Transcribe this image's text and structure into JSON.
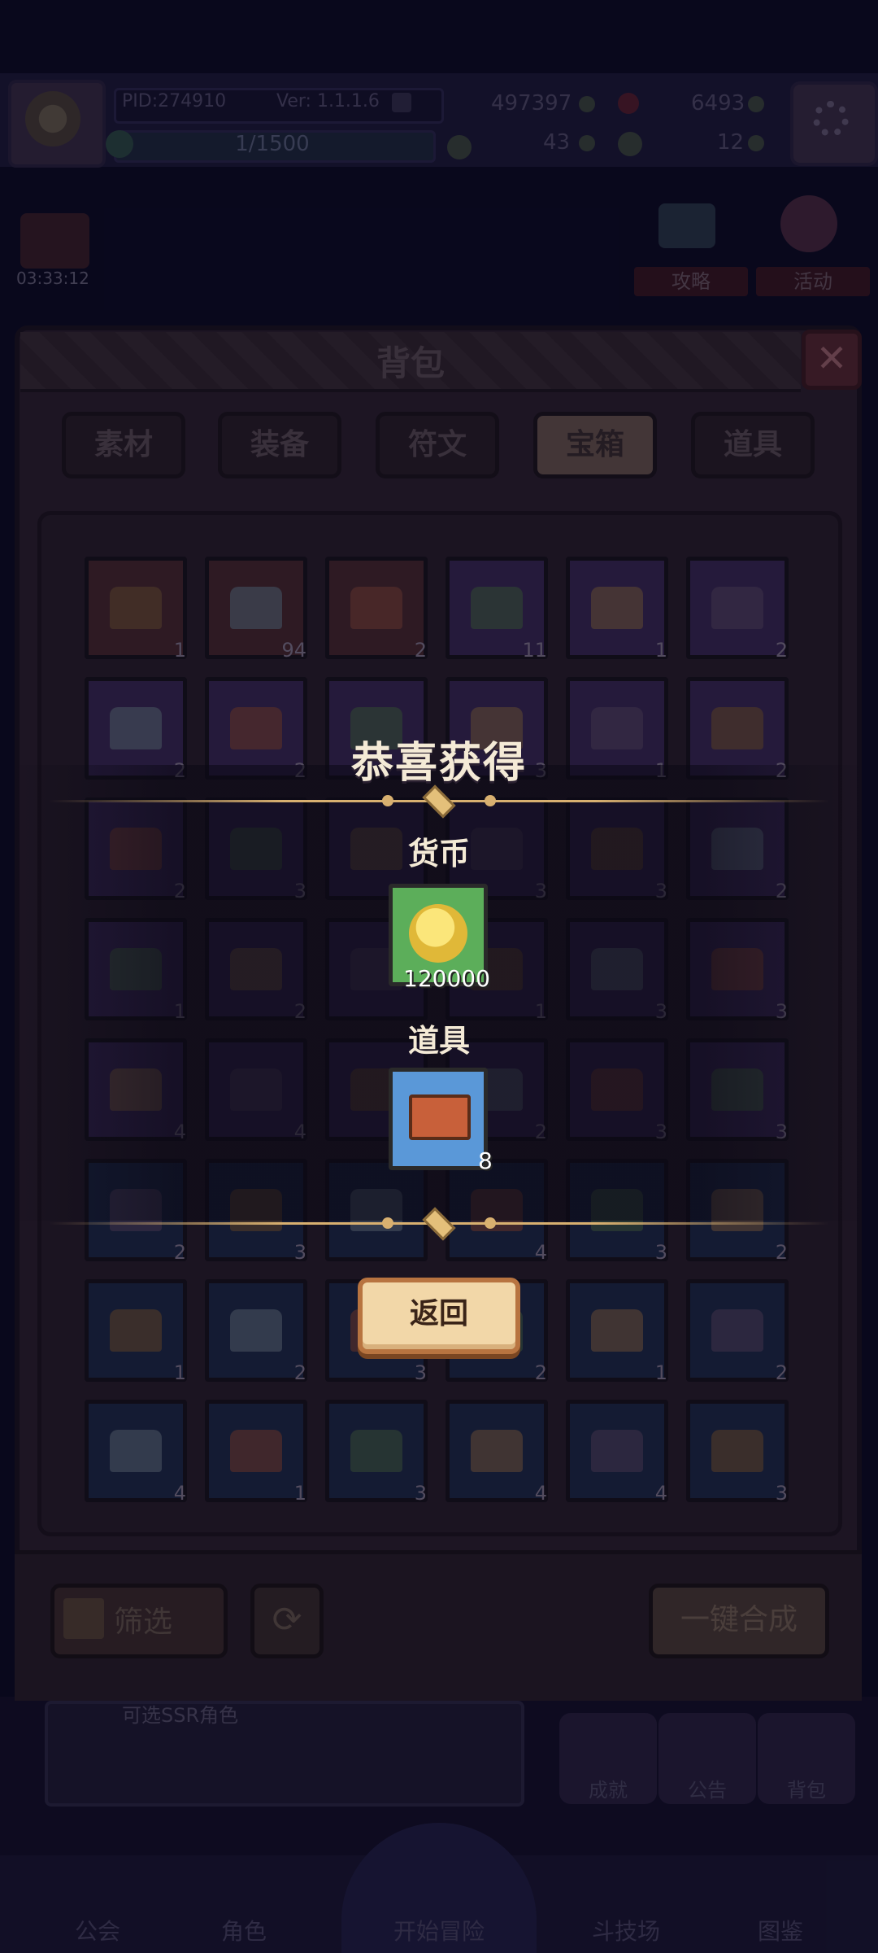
{
  "hud": {
    "pid": "PID:274910",
    "version": "Ver: 1.1.1.6",
    "exp": "1/1500",
    "gold": "497397",
    "gems": "6493",
    "clover": "43",
    "keys": "12"
  },
  "event_timer": "03:33:12",
  "side_buttons": [
    "攻略",
    "活动"
  ],
  "backpack": {
    "title": "背包",
    "close": "✕",
    "tabs": [
      {
        "label": "素材",
        "active": false
      },
      {
        "label": "装备",
        "active": false
      },
      {
        "label": "符文",
        "active": false
      },
      {
        "label": "宝箱",
        "active": true
      },
      {
        "label": "道具",
        "active": false
      }
    ],
    "rows": [
      [
        {
          "c": "1",
          "r": "red"
        },
        {
          "c": "94",
          "r": "red"
        },
        {
          "c": "2",
          "r": "red"
        },
        {
          "c": "11",
          "r": "purple"
        },
        {
          "c": "1",
          "r": "purple"
        },
        {
          "c": "2",
          "r": "purple"
        }
      ],
      [
        {
          "c": "2",
          "r": "purple"
        },
        {
          "c": "2",
          "r": "purple"
        },
        {
          "c": "",
          "r": "purple"
        },
        {
          "c": "3",
          "r": "purple"
        },
        {
          "c": "1",
          "r": "purple"
        },
        {
          "c": "2",
          "r": "purple"
        }
      ],
      [
        {
          "c": "2",
          "r": "purple"
        },
        {
          "c": "3",
          "r": "purple"
        },
        {
          "c": "",
          "r": "purple"
        },
        {
          "c": "3",
          "r": "purple"
        },
        {
          "c": "3",
          "r": "purple"
        },
        {
          "c": "2",
          "r": "purple"
        }
      ],
      [
        {
          "c": "1",
          "r": "purple"
        },
        {
          "c": "2",
          "r": "purple"
        },
        {
          "c": "",
          "r": "purple"
        },
        {
          "c": "1",
          "r": "purple"
        },
        {
          "c": "3",
          "r": "purple"
        },
        {
          "c": "3",
          "r": "purple"
        }
      ],
      [
        {
          "c": "4",
          "r": "purple"
        },
        {
          "c": "4",
          "r": "purple"
        },
        {
          "c": "",
          "r": "purple"
        },
        {
          "c": "2",
          "r": "purple"
        },
        {
          "c": "3",
          "r": "purple"
        },
        {
          "c": "3",
          "r": "purple"
        }
      ],
      [
        {
          "c": "2",
          "r": "blue"
        },
        {
          "c": "3",
          "r": "blue"
        },
        {
          "c": "",
          "r": "blue"
        },
        {
          "c": "4",
          "r": "blue"
        },
        {
          "c": "3",
          "r": "blue"
        },
        {
          "c": "2",
          "r": "blue"
        }
      ],
      [
        {
          "c": "1",
          "r": "blue"
        },
        {
          "c": "2",
          "r": "blue"
        },
        {
          "c": "3",
          "r": "blue"
        },
        {
          "c": "2",
          "r": "blue"
        },
        {
          "c": "1",
          "r": "blue"
        },
        {
          "c": "2",
          "r": "blue"
        }
      ],
      [
        {
          "c": "4",
          "r": "blue"
        },
        {
          "c": "1",
          "r": "blue"
        },
        {
          "c": "3",
          "r": "blue"
        },
        {
          "c": "4",
          "r": "blue"
        },
        {
          "c": "4",
          "r": "blue"
        },
        {
          "c": "3",
          "r": "blue"
        }
      ]
    ],
    "filter_label": "筛选",
    "refresh": "⟳",
    "merge_label": "一键合成"
  },
  "lower": {
    "news": "可选SSR角色",
    "mini_buttons": [
      "成就",
      "公告",
      "背包"
    ],
    "nav": [
      "公会",
      "角色",
      "开始冒险",
      "斗技场",
      "图鉴"
    ]
  },
  "reward": {
    "title": "恭喜获得",
    "currency_label": "货币",
    "currency_amount": "120000",
    "currency_icon": "gold-coin-icon",
    "item_label": "道具",
    "item_amount": "8",
    "item_icon": "scroll-book-icon",
    "return_label": "返回"
  },
  "colors": {
    "accent_gold": "#d8b070",
    "currency_bg": "#5cae5a",
    "item_bg": "#5a98d8",
    "return_button": "#f2d7a8"
  }
}
